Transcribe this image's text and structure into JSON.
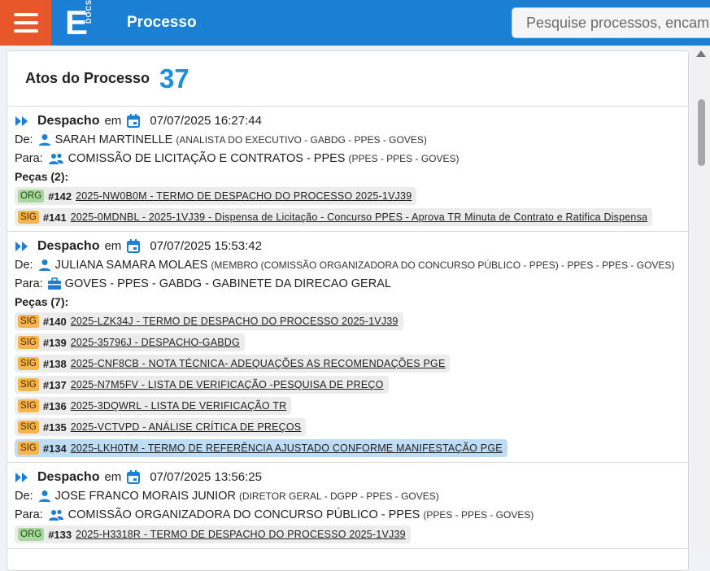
{
  "header": {
    "logo_letter": "E",
    "logo_sub": "DOCS",
    "title": "Processo",
    "search_placeholder": "Pesquise processos, encaminhamentos..."
  },
  "panel": {
    "title": "Atos do Processo",
    "count": "37"
  },
  "labels": {
    "em": "em",
    "de": "De:",
    "para": "Para:"
  },
  "acts": [
    {
      "type": "Despacho",
      "date": "07/07/2025 16:27:44",
      "de_name": "SARAH MARTINELLE",
      "de_detail": "(ANALISTA DO EXECUTIVO - GABDG - PPES - GOVES)",
      "para_name": "COMISSÃO DE LICITAÇÃO E CONTRATOS - PPES",
      "para_detail": "(PPES - PPES - GOVES)",
      "pecas_label": "Peças (2):",
      "pieces": [
        {
          "tag": "ORG",
          "num": "#142",
          "text": "2025-NW0B0M - TERMO DE DESPACHO DO PROCESSO 2025-1VJ39"
        },
        {
          "tag": "SIG",
          "num": "#141",
          "text": "2025-0MDNBL - 2025-1VJ39 - Dispensa de Licitação - Concurso PPES - Aprova TR Minuta de Contrato e Ratifica Dispensa"
        }
      ]
    },
    {
      "type": "Despacho",
      "date": "07/07/2025 15:53:42",
      "de_name": "JULIANA SAMARA MOLAES",
      "de_detail": "(MEMBRO (COMISSÃO ORGANIZADORA DO CONCURSO PÚBLICO - PPES) - PPES - PPES - GOVES)",
      "para_name": "GOVES - PPES - GABDG - GABINETE DA DIRECAO GERAL",
      "para_detail": "",
      "pecas_label": "Peças (7):",
      "pieces": [
        {
          "tag": "SIG",
          "num": "#140",
          "text": "2025-LZK34J - TERMO DE DESPACHO DO PROCESSO 2025-1VJ39"
        },
        {
          "tag": "SIG",
          "num": "#139",
          "text": "2025-35796J - DESPACHO-GABDG"
        },
        {
          "tag": "SIG",
          "num": "#138",
          "text": "2025-CNF8CB - NOTA TÉCNICA- ADEQUAÇÕES AS RECOMENDAÇÕES PGE"
        },
        {
          "tag": "SIG",
          "num": "#137",
          "text": "2025-N7M5FV - LISTA DE VERIFICAÇÃO -PESQUISA DE PREÇO"
        },
        {
          "tag": "SIG",
          "num": "#136",
          "text": "2025-3DQWRL - LISTA DE VERIFICAÇÃO TR"
        },
        {
          "tag": "SIG",
          "num": "#135",
          "text": "2025-VCTVPD - ANÁLISE CRÍTICA DE PREÇOS"
        },
        {
          "tag": "SIG",
          "num": "#134",
          "text": "2025-LKH0TM - TERMO DE REFERÊNCIA AJUSTADO CONFORME MANIFESTAÇÃO PGE"
        }
      ]
    },
    {
      "type": "Despacho",
      "date": "07/07/2025 13:56:25",
      "de_name": "JOSE FRANCO MORAIS JUNIOR",
      "de_detail": "(DIRETOR GERAL - DGPP - PPES - GOVES)",
      "para_name": "COMISSÃO ORGANIZADORA DO CONCURSO PÚBLICO - PPES",
      "para_detail": "(PPES - PPES - GOVES)",
      "pieces": [
        {
          "tag": "ORG",
          "num": "#133",
          "text": "2025-H3318R - TERMO DE DESPACHO DO PROCESSO 2025-1VJ39"
        }
      ]
    }
  ],
  "colors": {
    "header": "#1b7fd3",
    "menu": "#e8572a",
    "count": "#1b8fe0",
    "org": "#a8d89c",
    "sig": "#f5b54a",
    "highlight": "#bfdcf5"
  }
}
